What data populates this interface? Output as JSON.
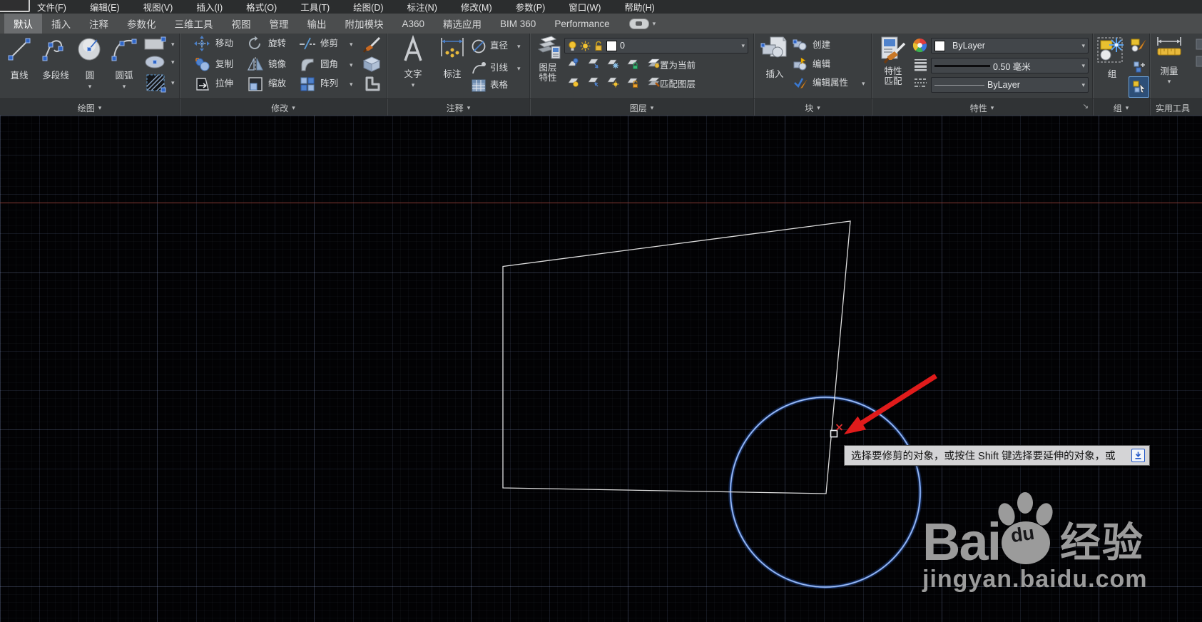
{
  "menu": {
    "items": [
      "文件(F)",
      "编辑(E)",
      "视图(V)",
      "插入(I)",
      "格式(O)",
      "工具(T)",
      "绘图(D)",
      "标注(N)",
      "修改(M)",
      "参数(P)",
      "窗口(W)",
      "帮助(H)"
    ]
  },
  "tabs": {
    "items": [
      "默认",
      "插入",
      "注释",
      "参数化",
      "三维工具",
      "视图",
      "管理",
      "输出",
      "附加模块",
      "A360",
      "精选应用",
      "BIM 360",
      "Performance"
    ]
  },
  "ribbon": {
    "draw": {
      "title": "绘图",
      "line": "直线",
      "polyline": "多段线",
      "circle": "圆",
      "arc": "圆弧"
    },
    "modify": {
      "title": "修改",
      "move": "移动",
      "rotate": "旋转",
      "trim": "修剪",
      "copy": "复制",
      "mirror": "镜像",
      "fillet": "圆角",
      "stretch": "拉伸",
      "scale": "缩放",
      "array": "阵列"
    },
    "annotate": {
      "title": "注释",
      "text": "文字",
      "dim": "标注",
      "diameter": "直径",
      "leader": "引线",
      "table": "表格"
    },
    "layers": {
      "title": "图层",
      "layer_props": "图层\n特性",
      "current_layer": "0",
      "set_current": "置为当前",
      "match_layer": "匹配图层"
    },
    "block": {
      "title": "块",
      "insert": "插入",
      "create": "创建",
      "edit": "编辑",
      "edit_attrs": "编辑属性"
    },
    "properties": {
      "title": "特性",
      "match_props": "特性\n匹配",
      "color": "ByLayer",
      "lineweight": "0.50 毫米",
      "linetype": "ByLayer"
    },
    "group": {
      "title": "组",
      "group": "组"
    },
    "utilities": {
      "title": "实用工具",
      "measure": "测量"
    }
  },
  "canvas": {
    "tooltip": "选择要修剪的对象，或按住 Shift 键选择要延伸的对象，或"
  },
  "watermark": {
    "bai": "Bai",
    "du": "du",
    "jingyan": "经验",
    "url": "jingyan.baidu.com"
  },
  "icons": {
    "dropdown": "▾",
    "launcher": "↘"
  },
  "colors": {
    "circle_blue": "#4d7fd6",
    "arrow_red": "#e01b1b",
    "construction_red": "#82332b",
    "tooltip_bg": "#d4d4d6"
  }
}
